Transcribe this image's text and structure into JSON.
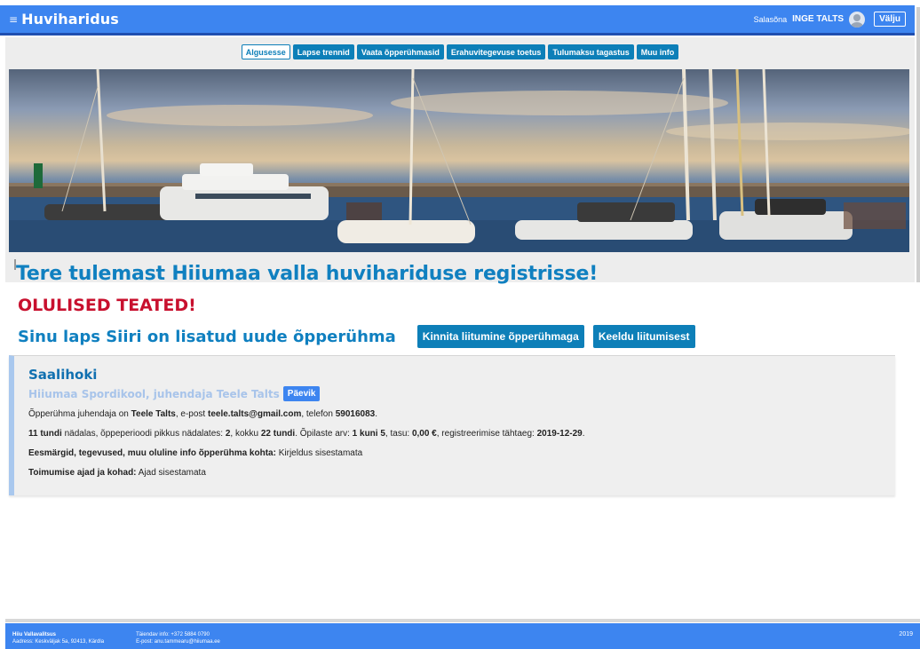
{
  "header": {
    "brand": "Huviharidus",
    "menu_glyph": "≡",
    "user_prefix": "Salasõna",
    "user_name": "INGE TALTS",
    "logout": "Välju"
  },
  "nav": {
    "tabs": [
      {
        "label": "Algusesse",
        "active": true
      },
      {
        "label": "Lapse trennid",
        "active": false
      },
      {
        "label": "Vaata õpperühmasid",
        "active": false
      },
      {
        "label": "Erahuvitegevuse toetus",
        "active": false
      },
      {
        "label": "Tulumaksu tagastus",
        "active": false
      },
      {
        "label": "Muu info",
        "active": false
      }
    ]
  },
  "main": {
    "welcome": "Tere tulemast Hiiumaa valla huvihariduse registrisse!",
    "notices": "OLULISED TEATED!",
    "child_message": "Sinu laps Siiri on lisatud uude õpperühma",
    "confirm_button": "Kinnita liitumine õpperühmaga",
    "decline_button": "Keeldu liitumisest"
  },
  "group": {
    "title": "Saalihoki",
    "subtitle": "Hiiumaa Spordikool, juhendaja Teele Talts",
    "diary_button": "Päevik",
    "line1": {
      "a": "Õpperühma juhendaja on ",
      "name": "Teele Talts",
      "b": ", e-post ",
      "email": "teele.talts@gmail.com",
      "c": ", telefon ",
      "phone": "59016083",
      "d": "."
    },
    "line2": {
      "hours": "11 tundi",
      "a": " nädalas, õppeperioodi pikkus nädalates: ",
      "weeks": "2",
      "b": ", kokku ",
      "total": "22 tundi",
      "c": ". Õpilaste arv: ",
      "pupils": "1 kuni 5",
      "d": ", tasu: ",
      "fee": "0,00 €",
      "e": ", registreerimise tähtaeg: ",
      "deadline": "2019-12-29",
      "f": "."
    },
    "line3": {
      "label": "Eesmärgid, tegevused, muu oluline info õpperühma kohta:",
      "value": " Kirjeldus sisestamata"
    },
    "line4": {
      "label": "Toimumise ajad ja kohad:",
      "value": " Ajad sisestamata"
    }
  },
  "footer": {
    "org": "Hiiu Vallavalitsus",
    "address": "Aadress: Keskväljak 5a, 92413, Kärdla",
    "info": "Täiendav info: +372 5884 0790",
    "email": "E-post: anu.tammearu@hiiumaa.ee",
    "year": "2019"
  },
  "colors": {
    "header_blue": "#3d85f0",
    "primary_button": "#0d7fb8",
    "title_blue": "#1080c0",
    "alert_red": "#c8102e"
  }
}
